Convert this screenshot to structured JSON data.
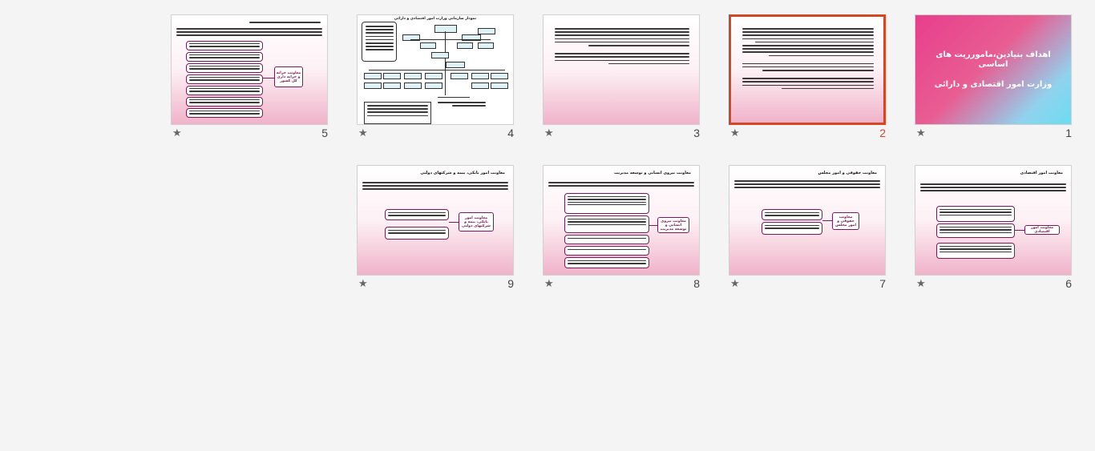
{
  "slides": [
    {
      "number": "1",
      "title_line1": "اهداف بنیادین،مامورریت های اساسی",
      "title_line2": "وزارت امور اقتصادی و دارائی"
    },
    {
      "number": "2",
      "selected": true
    },
    {
      "number": "3"
    },
    {
      "number": "4",
      "title": "نمودار سازمانی وزارت امور اقتصادی و دارائی"
    },
    {
      "number": "5"
    },
    {
      "number": "6",
      "title": "معاونت امور اقتصادی",
      "label": "معاونت امور اقتصادی"
    },
    {
      "number": "7",
      "title": "معاونت حقوقی و امور مجلس",
      "label": "معاونت حقوقی و امور مجلس"
    },
    {
      "number": "8",
      "title": "معاونت نیروی انسانی و توسعه مدیریت",
      "label": "معاونت نیروی انسانی و توسعه مدیریت"
    },
    {
      "number": "9",
      "title": "معاونت امور بانکی، بیمه و شرکتهای دولتی",
      "label": "معاونت امور بانکی، بیمه و شرکتهای دولتی"
    }
  ],
  "slide5": {
    "label": "معاونت خزانه و خزانه داری کل کشور"
  },
  "star_symbol": "★",
  "colors": {
    "selected_border": "#d24726",
    "box_border": "#7a1a55",
    "title_gradient_start": "#e83e8c",
    "title_gradient_end": "#6ddcf0"
  }
}
